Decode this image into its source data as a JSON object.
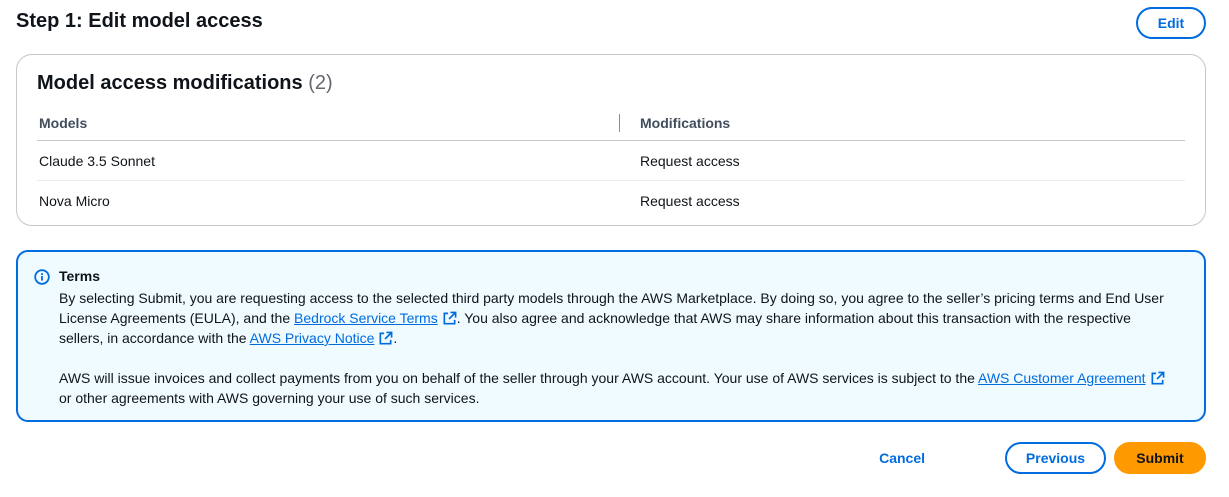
{
  "header": {
    "title": "Step 1: Edit model access",
    "edit_label": "Edit"
  },
  "modifications": {
    "title": "Model access modifications",
    "count": "(2)",
    "columns": [
      "Models",
      "Modifications"
    ],
    "rows": [
      {
        "model": "Claude 3.5 Sonnet",
        "modification": "Request access"
      },
      {
        "model": "Nova Micro",
        "modification": "Request access"
      }
    ]
  },
  "terms": {
    "title": "Terms",
    "p1_a": "By selecting Submit, you are requesting access to the selected third party models through the AWS Marketplace. By doing so, you agree to the seller’s pricing terms and End User License Agreements (EULA), and the ",
    "link_bedrock": "Bedrock Service Terms",
    "p1_b": ". You also agree and acknowledge that AWS may share information about this transaction with the respective sellers, in accordance with the ",
    "link_privacy": "AWS Privacy Notice",
    "p1_c": ".",
    "p2_a": "AWS will issue invoices and collect payments from you on behalf of the seller through your AWS account. Your use of AWS services is subject to the ",
    "link_customer": "AWS Customer Agreement",
    "p2_b": " or other agreements with AWS governing your use of such services."
  },
  "footer": {
    "cancel_label": "Cancel",
    "previous_label": "Previous",
    "submit_label": "Submit"
  },
  "icons": {
    "info": "info-circle-icon",
    "external": "external-link-icon"
  },
  "colors": {
    "primary": "#006ce0",
    "submit": "#ff9900",
    "alert_bg": "#f0fbff"
  }
}
